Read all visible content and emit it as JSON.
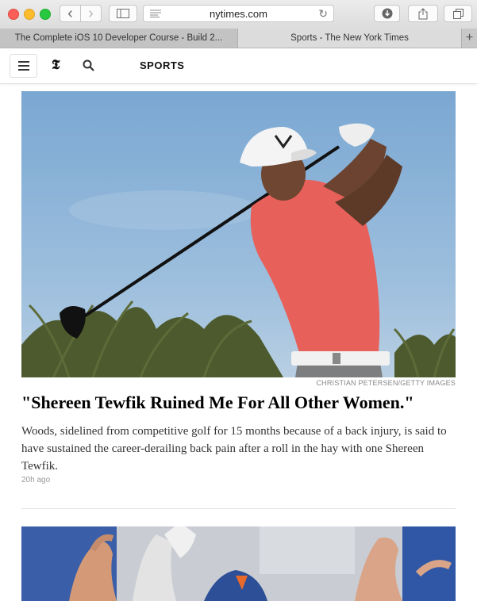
{
  "browser": {
    "address": "nytimes.com",
    "tabs": [
      {
        "label": "The Complete iOS 10 Developer Course - Build 2..."
      },
      {
        "label": "Sports - The New York Times"
      }
    ],
    "new_tab": "+"
  },
  "header": {
    "section": "SPORTS",
    "logo": "𝕿"
  },
  "article": {
    "credit": "CHRISTIAN PETERSEN/GETTY IMAGES",
    "headline": "\"Shereen Tewfik Ruined Me For All Other Women.\"",
    "summary": "Woods, sidelined from competitive golf for 15 months because of a back injury, is said to have sustained the career-derailing back pain after a roll in the hay with one Shereen Tewfik.",
    "timestamp": "20h ago"
  },
  "icons": {
    "back": "‹",
    "forward": "›",
    "reload": "↻",
    "search": "search-icon",
    "menu": "hamburger-icon"
  },
  "colors": {
    "close": "#fc5f57",
    "minimize": "#fdbc2e",
    "zoom": "#28c840",
    "sky": "#8fb4d6",
    "shirt": "#e86058"
  }
}
